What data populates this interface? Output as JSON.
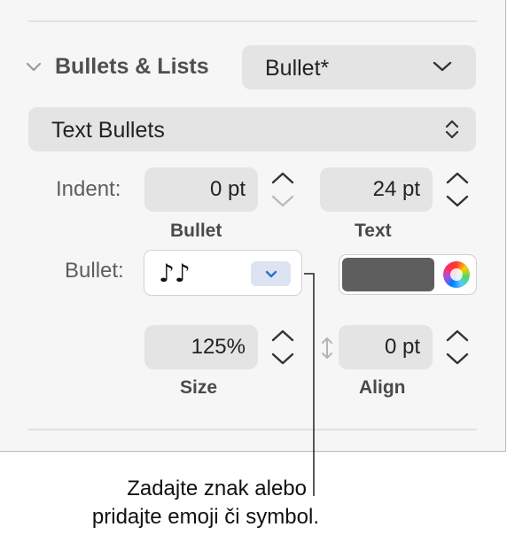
{
  "section": {
    "title": "Bullets & Lists",
    "style_value": "Bullet*"
  },
  "list_type": {
    "value": "Text Bullets"
  },
  "indent": {
    "label": "Indent:",
    "bullet_value": "0 pt",
    "bullet_caption": "Bullet",
    "text_value": "24 pt",
    "text_caption": "Text"
  },
  "bullet": {
    "label": "Bullet:",
    "glyph": "♪♪",
    "color_hex": "#5e5e5e"
  },
  "size": {
    "value": "125%",
    "caption": "Size"
  },
  "align": {
    "value": "0 pt",
    "caption": "Align"
  },
  "callout": {
    "line1": "Zadajte znak alebo",
    "line2": "pridajte emoji či symbol."
  }
}
